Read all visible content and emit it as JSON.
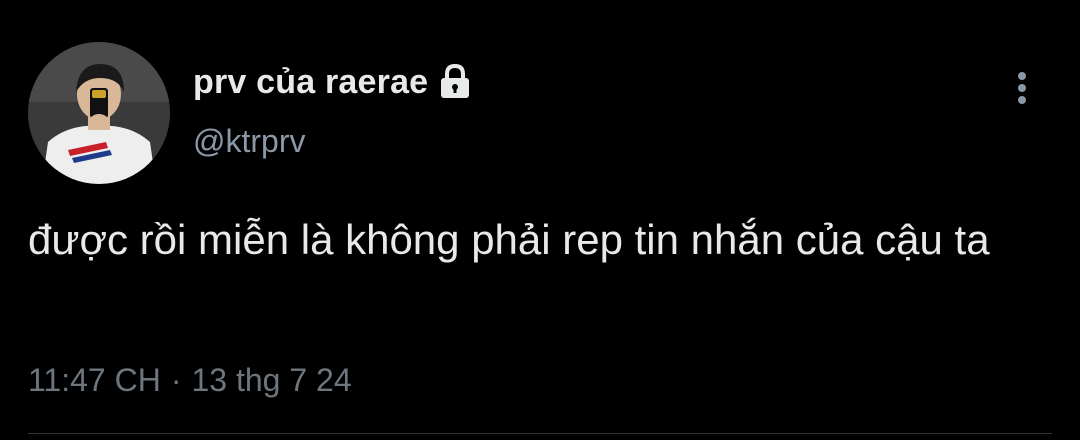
{
  "tweet": {
    "display_name": "prv của raerae",
    "handle": "@ktrprv",
    "text": "được rồi miễn là không phải rep tin nhắn của cậu ta",
    "time": "11:47 CH",
    "separator": "·",
    "date": "13 thg 7 24"
  },
  "icons": {
    "lock": "lock-icon",
    "more": "more-vertical-icon",
    "avatar": "avatar"
  },
  "colors": {
    "background": "#000000",
    "primary_text": "#e7e9ea",
    "secondary_text": "#8b98a5",
    "meta_text": "#6e767d"
  }
}
